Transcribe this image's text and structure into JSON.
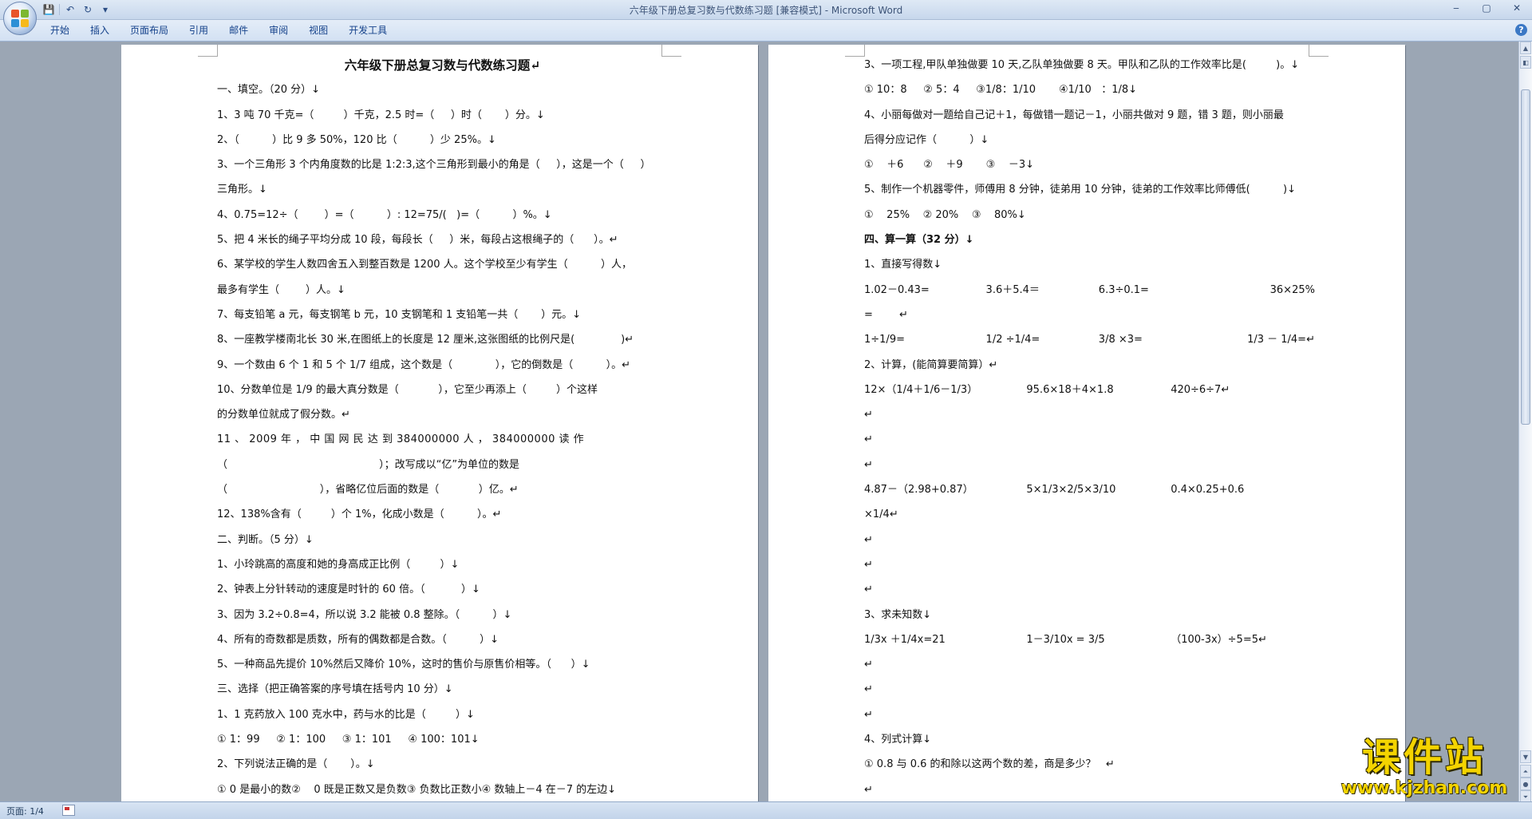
{
  "window": {
    "title": "六年级下册总复习数与代数练习题 [兼容模式] - Microsoft Word",
    "controls": [
      "‒",
      "▢",
      "✕"
    ]
  },
  "quick_access": {
    "save": "💾",
    "undo": "↶",
    "redo": "↻",
    "more": "▾"
  },
  "ribbon": {
    "tabs": [
      "开始",
      "插入",
      "页面布局",
      "引用",
      "邮件",
      "审阅",
      "视图",
      "开发工具"
    ],
    "help": "?"
  },
  "left_page": {
    "lines": [
      "六年级下册总复习数与代数练习题↵",
      "一、填空。（20 分）↓",
      "1、3 吨 70 千克=（         ）千克，2.5 时=（     ）时（       ）分。↓",
      "2、（          ）比 9 多 50%，120 比（          ）少 25%。↓",
      "3、一个三角形 3 个内角度数的比是 1:2:3,这个三角形到最小的角是（     ），这是一个（     ）",
      "三角形。↓",
      "4、0.75=12÷（        ）=（          ）: 12=75/(   )=（          ）%。↓",
      "5、把 4 米长的绳子平均分成 10 段，每段长（     ）米，每段占这根绳子的（      ）。↵",
      "6、某学校的学生人数四舍五入到整百数是 1200 人。这个学校至少有学生（          ）人，",
      "最多有学生（        ）人。↓",
      "7、每支铅笔 a 元，每支钢笔 b 元，10 支钢笔和 1 支铅笔一共（       ）元。↓",
      "8、一座教学楼南北长 30 米,在图纸上的长度是 12 厘米,这张图纸的比例尺是(              )↵",
      "9、一个数由 6 个 1 和 5 个 1/7 组成，这个数是（             ），它的倒数是（          ）。↵",
      "10、分数单位是 1/9 的最大真分数是（            ），它至少再添上（         ）个这样",
      "的分数单位就成了假分数。↵",
      "11 、 2009 年 ， 中 国 网 民 达 到 384000000 人 ， 384000000 读 作",
      "（                                              ）；改写成以“亿”为单位的数是",
      "（                            ），省略亿位后面的数是（            ）亿。↵",
      "12、138%含有（         ）个 1%，化成小数是（          ）。↵",
      "二、判断。（5 分）↓",
      "1、小玲跳高的高度和她的身高成正比例（         ）↓",
      "2、钟表上分针转动的速度是时针的 60 倍。（           ）↓",
      "3、因为 3.2÷0.8=4，所以说 3.2 能被 0.8 整除。（          ）↓",
      "4、所有的奇数都是质数，所有的偶数都是合数。（          ）↓",
      "5、一种商品先提价 10%然后又降价 10%，这时的售价与原售价相等。（      ）↓",
      "三、选择（把正确答案的序号填在括号内 10 分）↓",
      "1、1 克药放入 100 克水中，药与水的比是（         ）↓",
      "① 1：99     ② 1：100     ③ 1：101     ④ 100：101↓",
      "2、下列说法正确的是（       ）。↓",
      "① 0 是最小的数②    0 既是正数又是负数③ 负数比正数小④ 数轴上－4 在－7 的左边↓"
    ]
  },
  "right_page": {
    "lines": [
      "3、一项工程,甲队单独做要 10 天,乙队单独做要 8 天。甲队和乙队的工作效率比是(         )。↓",
      "① 10：8     ② 5：4     ③1/8：1/10       ④1/10   ：1/8↓",
      "4、小丽每做对一题给自己记＋1，每做错一题记－1，小丽共做对 9 题，错 3 题，则小丽最",
      "后得分应记作（          ）↓",
      "①    ＋6      ②    ＋9       ③    －3↓",
      "5、制作一个机器零件，师傅用 8 分钟，徒弟用 10 分钟，徒弟的工作效率比师傅低(          )↓",
      "①    25%    ② 20%    ③    80%↓",
      "四、算一算（32 分）↓",
      "1、直接写得数↓",
      [
        "1.02－0.43=",
        "3.6＋5.4＝",
        "6.3÷0.1=",
        "36×25%"
      ],
      "=        ↵",
      [
        "1÷1/9=",
        "1/2 ÷1/4=",
        "3/8 ×3=",
        "1/3 － 1/4=↵"
      ],
      "2、计算，(能简算要简算）↵",
      [
        "12×（1/4＋1/6－1/3）",
        "95.6×18＋4×1.8",
        "420÷6÷7↵"
      ],
      "↵",
      "↵",
      "↵",
      [
        "4.87－（2.98+0.87）",
        "5×1/3×2/5×3/10",
        "0.4×0.25+0.6"
      ],
      "×1/4↵",
      "↵",
      "↵",
      "↵",
      "3、求未知数↓",
      [
        "1/3x ＋1/4x=21",
        "1－3/10x = 3/5",
        "（100-3x）÷5=5↵"
      ],
      "↵",
      "↵",
      "↵",
      "4、列式计算↓",
      "① 0.8 与 0.6 的和除以这两个数的差，商是多少？   ↵",
      "↵"
    ]
  },
  "status_bar": {
    "page": "页面: 1/4"
  },
  "watermark": {
    "cn": "课件站",
    "url": "www.kjzhan.com"
  },
  "colors": {
    "ribbon_text": "#15428b",
    "watermark": "#f4d400",
    "background": "#9ba6b4"
  }
}
